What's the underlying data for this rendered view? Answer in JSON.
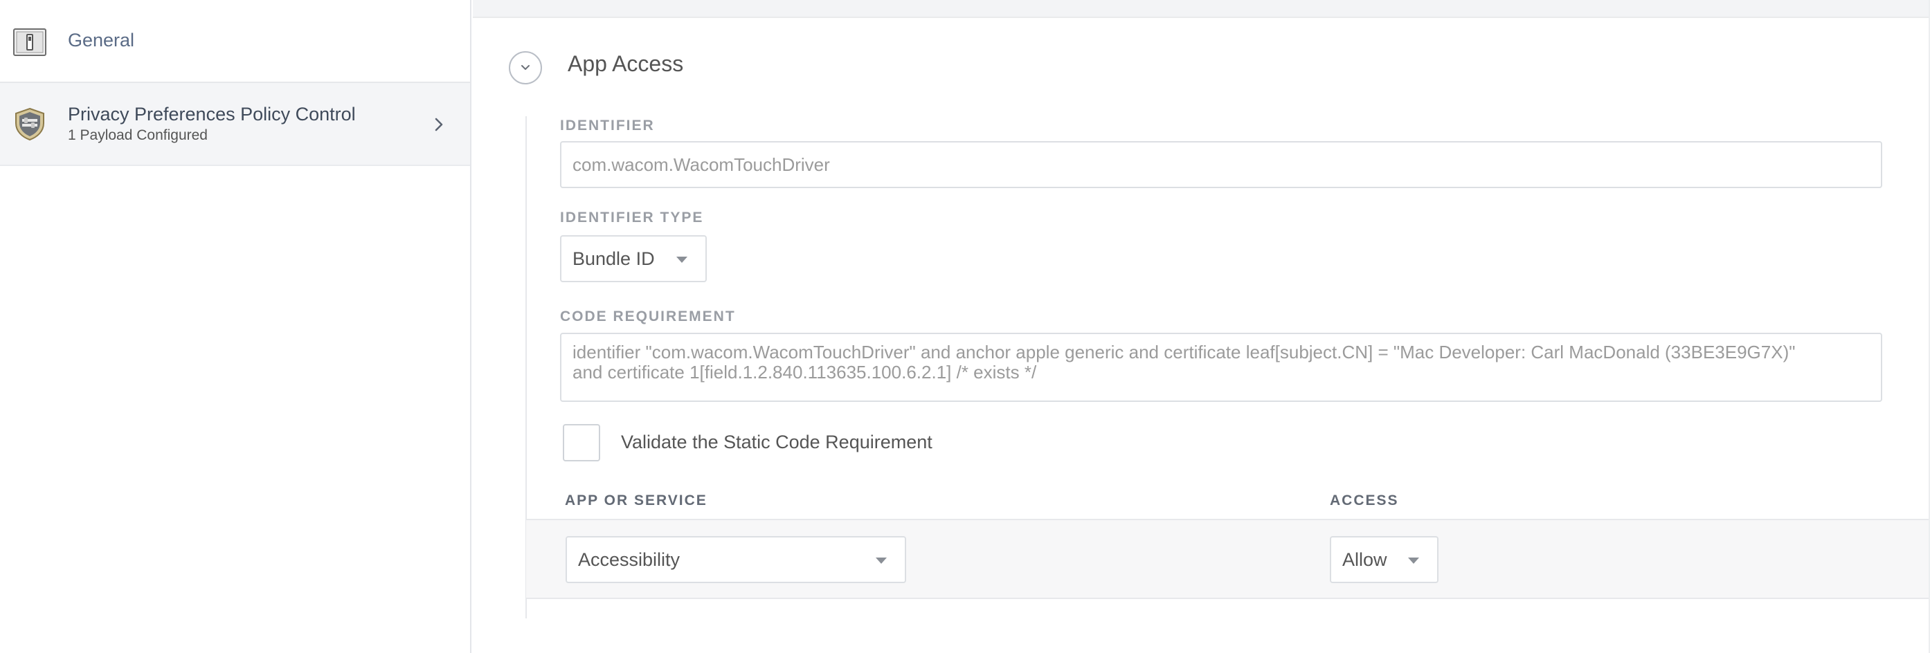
{
  "sidebar": {
    "items": [
      {
        "label": "General",
        "icon": "general-settings-icon"
      },
      {
        "label": "Privacy Preferences Policy Control",
        "sublabel": "1 Payload Configured",
        "icon": "privacy-shield-icon"
      }
    ]
  },
  "section": {
    "title": "App Access",
    "collapse_icon": "chevron-down-icon"
  },
  "form": {
    "identifier_label": "IDENTIFIER",
    "identifier_value": "com.wacom.WacomTouchDriver",
    "identifier_type_label": "IDENTIFIER TYPE",
    "identifier_type_value": "Bundle ID",
    "code_requirement_label": "CODE REQUIREMENT",
    "code_requirement_value": "identifier \"com.wacom.WacomTouchDriver\" and anchor apple generic and certificate leaf[subject.CN] = \"Mac Developer: Carl MacDonald (33BE3E9G7X)\"\nand certificate 1[field.1.2.840.113635.100.6.2.1] /* exists */",
    "validate_label": "Validate the Static Code Requirement",
    "validate_checked": false
  },
  "services": {
    "app_header": "APP OR SERVICE",
    "access_header": "ACCESS",
    "rows": [
      {
        "app": "Accessibility",
        "access": "Allow"
      }
    ]
  },
  "colors": {
    "sidebar_active_bg": "#f4f5f7",
    "label_gray": "#9a9ea5",
    "heading_gray": "#636a75",
    "border": "#dcdfe3"
  }
}
